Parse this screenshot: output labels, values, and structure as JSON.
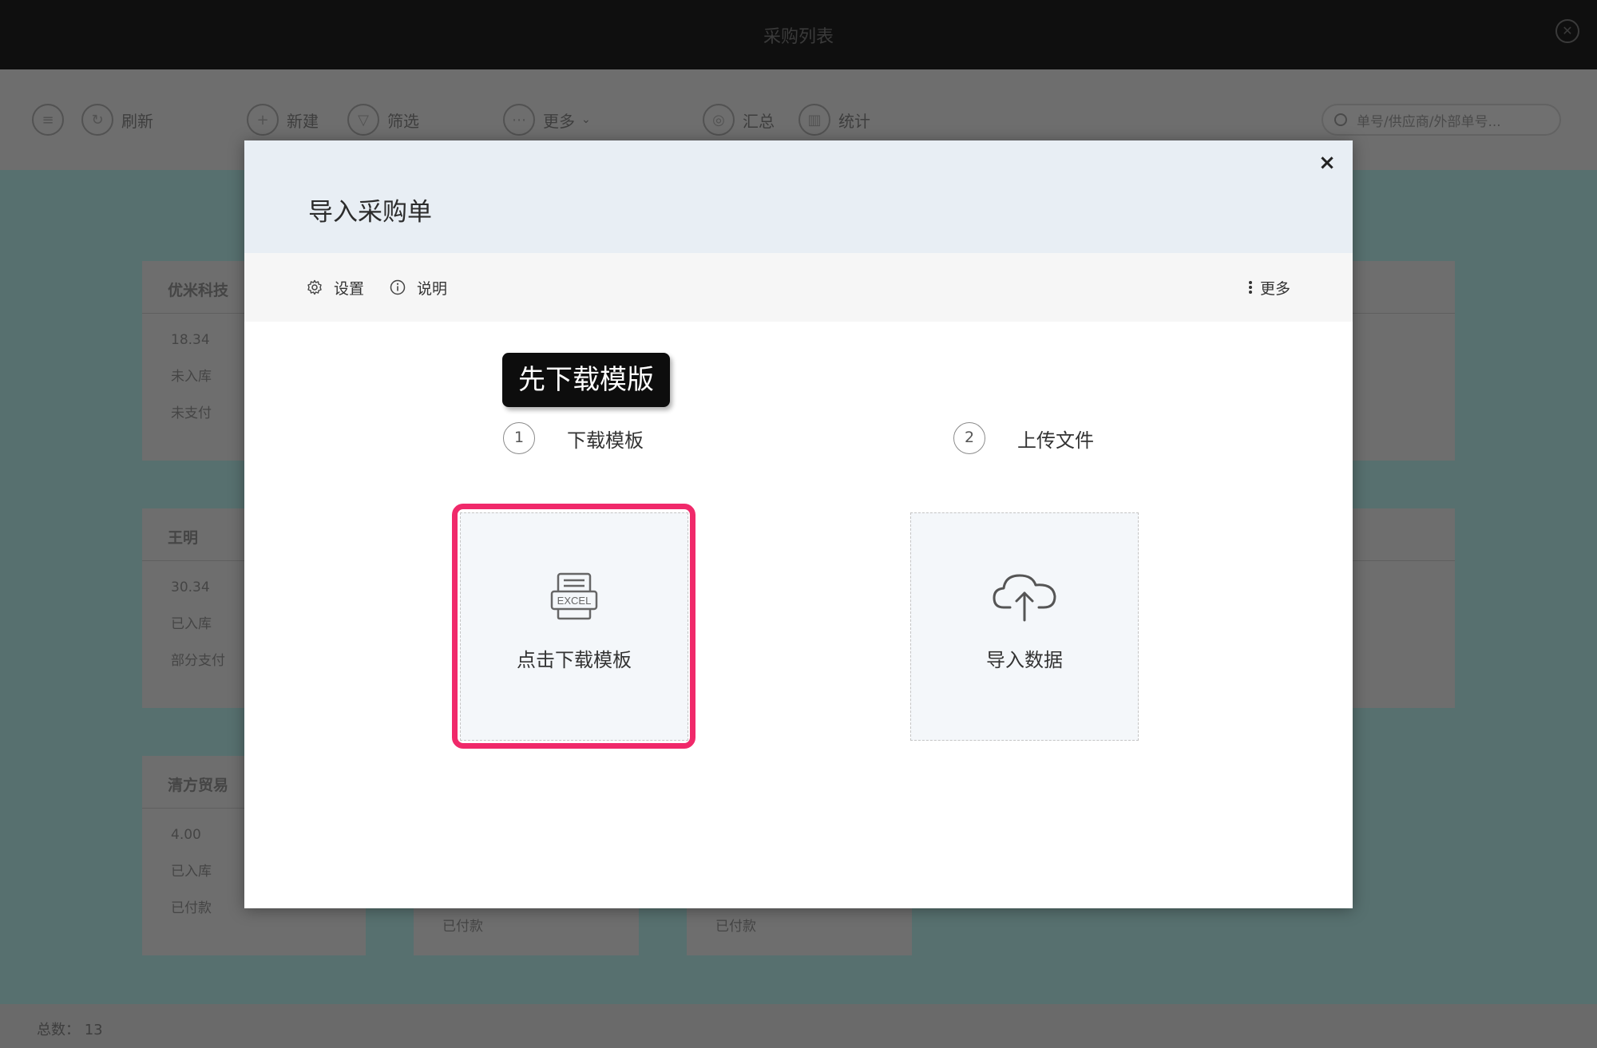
{
  "app": {
    "window_title": "采购列表",
    "toolbar": {
      "refresh_label": "刷新",
      "new_label": "新建",
      "filter_label": "筛选",
      "more_label": "更多",
      "summary_label": "汇总",
      "stats_label": "统计",
      "search_placeholder": "单号/供应商/外部单号..."
    },
    "cards": [
      {
        "name": "优米科技",
        "amount": "18.34",
        "stock_status": "未入库",
        "pay_status": "未支付"
      },
      {
        "name": "王明",
        "amount": "30.34",
        "stock_status": "已入库",
        "pay_status": "部分支付"
      },
      {
        "name": "清方贸易",
        "amount": "4.00",
        "stock_status": "已入库",
        "pay_status": "已付款"
      }
    ],
    "stub_labels": [
      "已付款",
      "已付款"
    ],
    "total_label": "总数：",
    "total_value": "13"
  },
  "dialog": {
    "title": "导入采购单",
    "toolbar": {
      "settings_label": "设置",
      "help_label": "说明",
      "more_label": "更多"
    },
    "tooltip": "先下载模版",
    "steps": [
      {
        "number": "1",
        "label": "下载模板"
      },
      {
        "number": "2",
        "label": "上传文件"
      }
    ],
    "download_tile": {
      "icon_text": "EXCEL",
      "label": "点击下载模板"
    },
    "upload_tile": {
      "label": "导入数据"
    },
    "highlight_color": "#f0296a"
  }
}
